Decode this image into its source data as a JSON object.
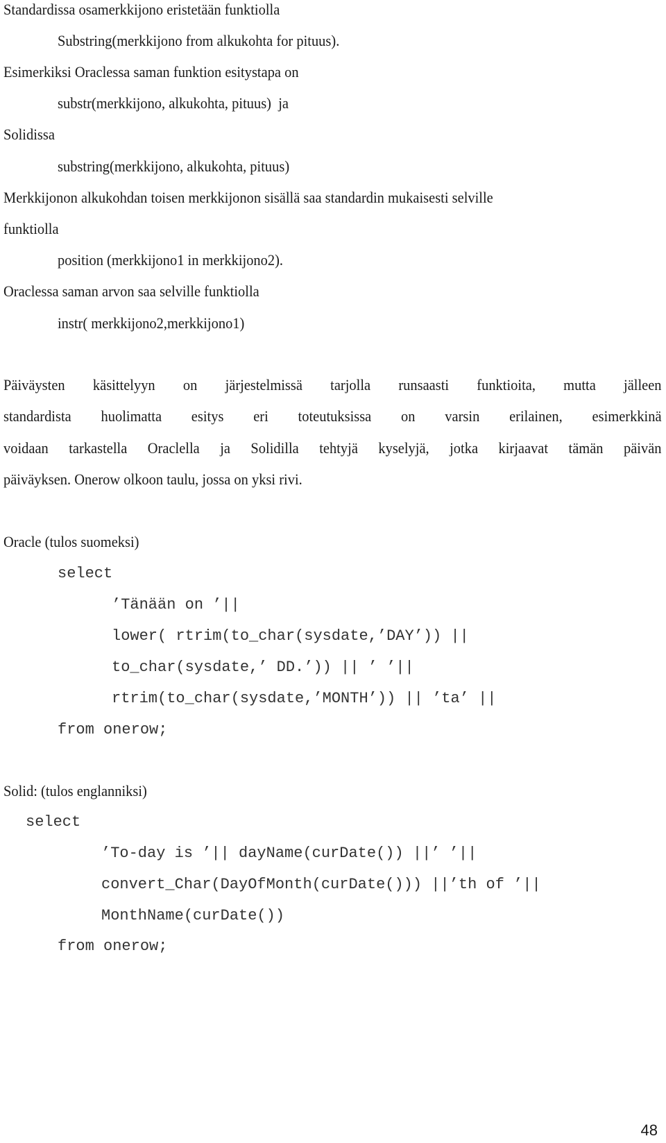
{
  "document": {
    "section1": {
      "intro": "Standardissa osamerkkijono eristetään funktiolla",
      "standard_func": "Substring(merkkijono from alkukohta for pituus).",
      "oracle_intro": "Esimerkiksi Oraclessa saman funktion esitystapa on",
      "oracle_func": "substr(merkkijono, alkukohta, pituus)  ja",
      "solid_intro": "Solidissa",
      "solid_func": "substring(merkkijono, alkukohta, pituus)"
    },
    "section2": {
      "intro_line1": "Merkkijonon alkukohdan toisen merkkijonon sisällä saa standardin mukaisesti selville",
      "intro_line2": "funktiolla",
      "standard_func": "position (merkkijono1 in merkkijono2).",
      "oracle_intro": "Oraclessa saman arvon saa selville funktiolla",
      "oracle_func": "instr( merkkijono2,merkkijono1)"
    },
    "paragraph": {
      "lines": [
        [
          "Päiväysten",
          "käsittelyyn",
          "on",
          "järjestelmissä",
          "tarjolla",
          "runsaasti",
          "funktioita,",
          "mutta",
          "jälleen"
        ],
        [
          "standardista",
          "huolimatta",
          "esitys",
          "eri",
          "toteutuksissa",
          "on",
          "varsin",
          "erilainen,",
          "esimerkkinä"
        ],
        [
          "voidaan",
          "tarkastella",
          "Oraclella",
          "ja",
          "Solidilla",
          "tehtyjä",
          "kyselyjä,",
          "jotka",
          "kirjaavat",
          "tämän",
          "päivän"
        ]
      ],
      "last_line": "päiväyksen. Onerow olkoon taulu, jossa on yksi rivi."
    },
    "oracle_example": {
      "heading": "Oracle (tulos suomeksi)",
      "code_select": "select",
      "code_lines": [
        "’Tänään on ’||",
        "lower( rtrim(to_char(sysdate,’DAY’)) ||",
        "to_char(sysdate,’ DD.’)) || ’ ’||",
        "rtrim(to_char(sysdate,’MONTH’)) || ’ta’ ||"
      ],
      "code_from": "from onerow;"
    },
    "solid_example": {
      "heading": "Solid: (tulos englanniksi)",
      "code_select": "select",
      "code_lines": [
        "’To-day is ’|| dayName(curDate()) ||’ ’||",
        "convert_Char(DayOfMonth(curDate())) ||’th of ’||",
        "MonthName(curDate())"
      ],
      "code_from": "from onerow;"
    },
    "page_number": "48"
  }
}
